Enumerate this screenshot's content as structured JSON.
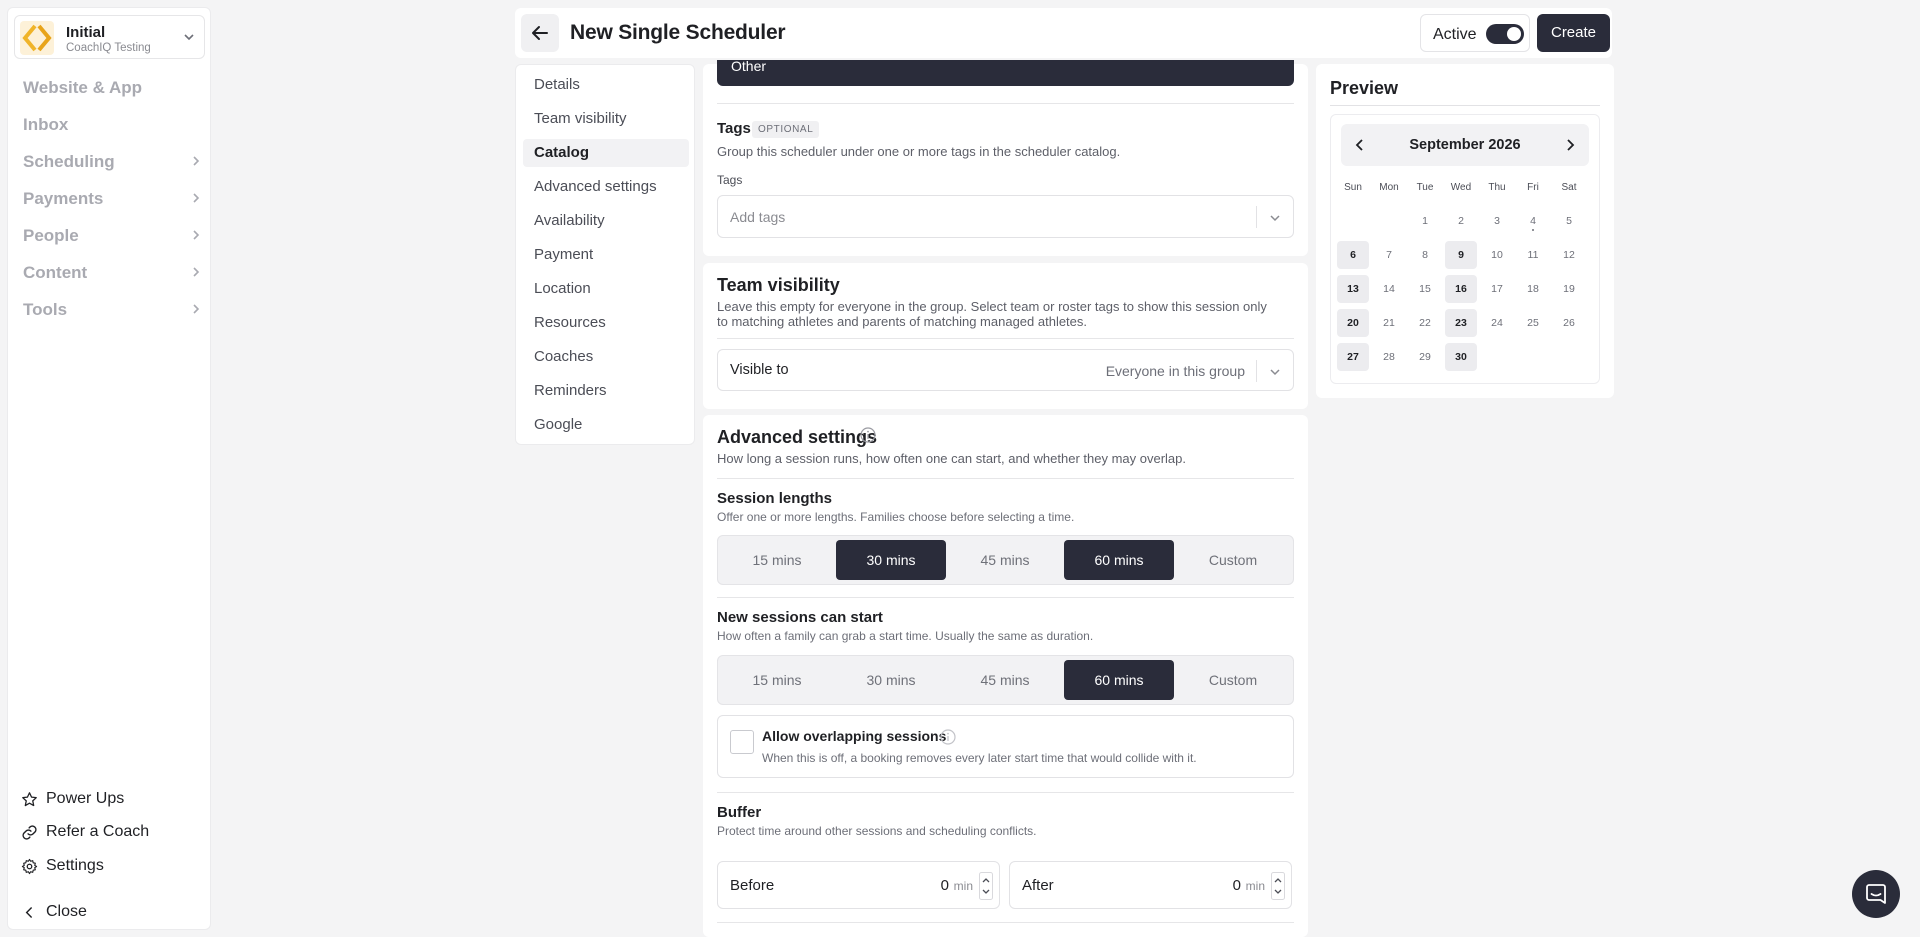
{
  "sidebar": {
    "org": {
      "name": "Initial",
      "subtitle": "CoachIQ Testing"
    },
    "nav": [
      {
        "label": "Website & App",
        "has_children": false
      },
      {
        "label": "Inbox",
        "has_children": false
      },
      {
        "label": "Scheduling",
        "has_children": true
      },
      {
        "label": "Payments",
        "has_children": true
      },
      {
        "label": "People",
        "has_children": true
      },
      {
        "label": "Content",
        "has_children": true
      },
      {
        "label": "Tools",
        "has_children": true
      }
    ],
    "bottom": {
      "power_ups": "Power Ups",
      "refer": "Refer a Coach",
      "settings": "Settings",
      "close": "Close"
    }
  },
  "header": {
    "title": "New Single Scheduler",
    "active_label": "Active",
    "active_on": true,
    "create_label": "Create"
  },
  "section_nav": {
    "items": [
      "Details",
      "Team visibility",
      "Catalog",
      "Advanced settings",
      "Availability",
      "Payment",
      "Location",
      "Resources",
      "Coaches",
      "Reminders",
      "Google"
    ],
    "active": "Catalog"
  },
  "catalog": {
    "top_button_partial": "Other",
    "tags_title": "Tags",
    "tags_badge": "OPTIONAL",
    "tags_desc": "Group this scheduler under one or more tags in the scheduler catalog.",
    "tags_field_label": "Tags",
    "tags_placeholder": "Add tags"
  },
  "team_visibility": {
    "title": "Team visibility",
    "desc": "Leave this empty for everyone in the group. Select team or roster tags to show this session only to matching athletes and parents of matching managed athletes.",
    "visible_label": "Visible to",
    "visible_value": "Everyone in this group"
  },
  "advanced": {
    "title": "Advanced settings",
    "desc": "How long a session runs, how often one can start, and whether they may overlap.",
    "session_lengths": {
      "title": "Session lengths",
      "desc": "Offer one or more lengths. Families choose before selecting a time.",
      "options": [
        "15 mins",
        "30 mins",
        "45 mins",
        "60 mins",
        "Custom"
      ],
      "selected": [
        "30 mins",
        "60 mins"
      ]
    },
    "start_interval": {
      "title": "New sessions can start",
      "desc": "How often a family can grab a start time. Usually the same as duration.",
      "options": [
        "15 mins",
        "30 mins",
        "45 mins",
        "60 mins",
        "Custom"
      ],
      "selected": [
        "60 mins"
      ]
    },
    "overlap": {
      "title": "Allow overlapping sessions",
      "desc": "When this is off, a booking removes every later start time that would collide with it.",
      "checked": false
    },
    "buffer": {
      "title": "Buffer",
      "desc": "Protect time around other sessions and scheduling conflicts.",
      "before_label": "Before",
      "before_value": "0",
      "after_label": "After",
      "after_value": "0",
      "unit": "min"
    }
  },
  "preview": {
    "title": "Preview",
    "month": "September 2026",
    "weekdays": [
      "Sun",
      "Mon",
      "Tue",
      "Wed",
      "Thu",
      "Fri",
      "Sat"
    ],
    "first_weekday_index": 2,
    "days_in_month": 30,
    "available_days": [
      6,
      9,
      13,
      16,
      20,
      23,
      27,
      30
    ],
    "today": 4
  },
  "colors": {
    "primary": "#2a2c3a",
    "muted_nav": "#a9aab1",
    "background": "#f4f4f5",
    "logo_accent": "#f0b429"
  }
}
